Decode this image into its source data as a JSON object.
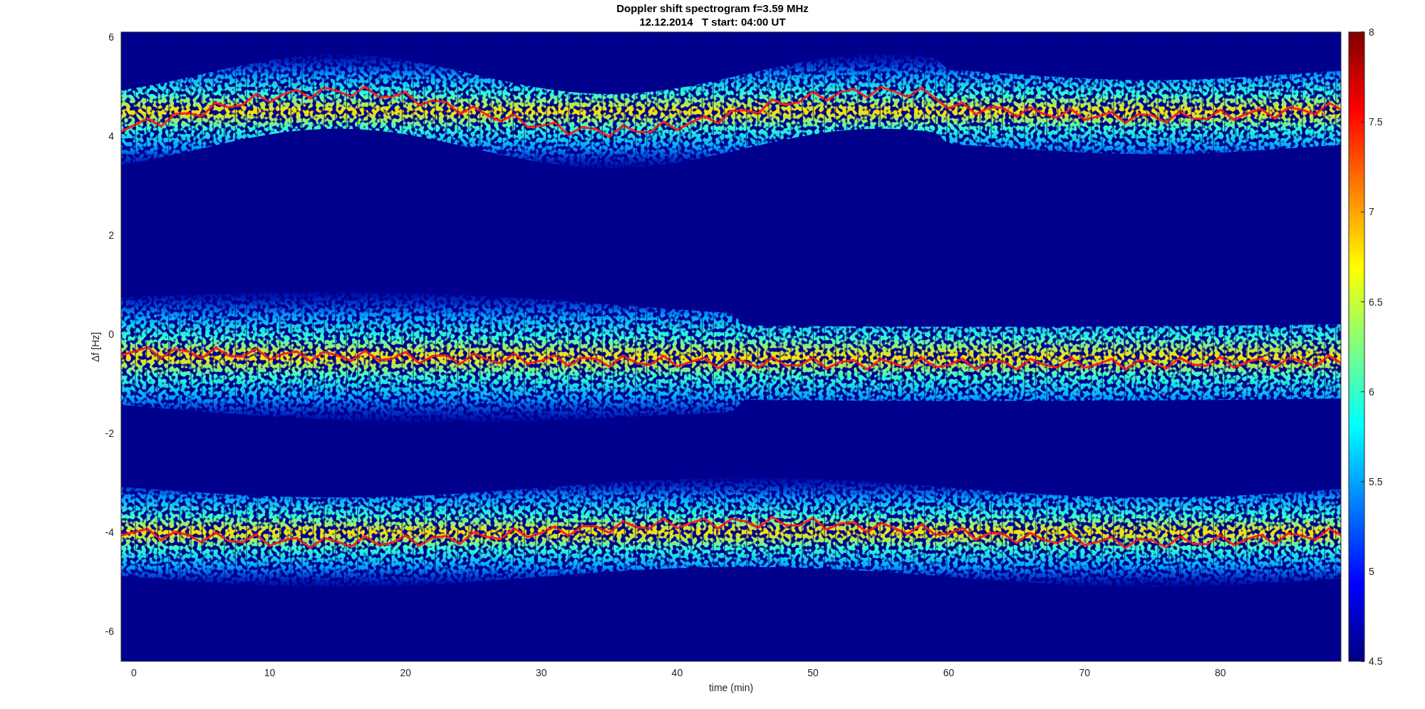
{
  "figure": {
    "title": "Doppler shift spectrogram f=3.59 MHz",
    "subtitle": "12.12.2014   T start: 04:00 UT",
    "xlabel": "time (min)",
    "ylabel": "Δf [Hz]",
    "xticks": [
      "0",
      "10",
      "20",
      "30",
      "40",
      "50",
      "60",
      "70",
      "80"
    ],
    "yticks": [
      "6",
      "4",
      "2",
      "0",
      "-2",
      "-4",
      "-6"
    ],
    "colorbar_ticks": [
      "8",
      "7.5",
      "7",
      "6.5",
      "6",
      "5.5",
      "5",
      "4.5"
    ]
  }
}
